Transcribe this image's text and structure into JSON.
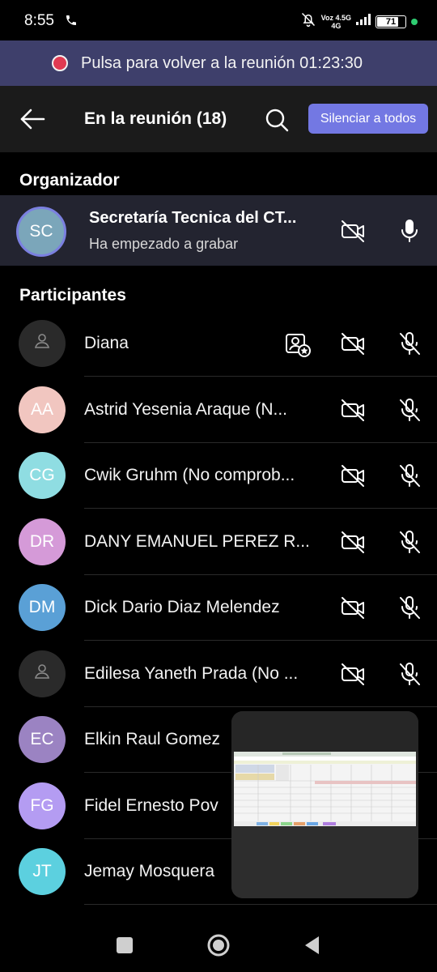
{
  "status_bar": {
    "time": "8:55",
    "net_top": "Voz 4.5G",
    "net_bottom": "4G",
    "battery": "71"
  },
  "banner": {
    "text": "Pulsa para volver a la reunión 01:23:30"
  },
  "header": {
    "title": "En la reunión (18)",
    "mute_all_label": "Silenciar a todos"
  },
  "organizer_section": {
    "title": "Organizador",
    "organizer": {
      "initials": "SC",
      "name": "Secretaría Tecnica  del CT...",
      "status": "Ha empezado a grabar"
    }
  },
  "participants_section": {
    "title": "Participantes",
    "participants": [
      {
        "initials": "",
        "name": "Diana",
        "avatar_color": "#2a2a2a"
      },
      {
        "initials": "AA",
        "name": "Astrid Yesenia  Araque (N...",
        "avatar_color": "#f1c6c0"
      },
      {
        "initials": "CG",
        "name": "Cwik Gruhm (No comprob...",
        "avatar_color": "#8fdde2"
      },
      {
        "initials": "DR",
        "name": "DANY EMANUEL PEREZ R...",
        "avatar_color": "#d59ad8"
      },
      {
        "initials": "DM",
        "name": "Dick Dario Diaz Melendez",
        "avatar_color": "#5aa0d6"
      },
      {
        "initials": "",
        "name": "Edilesa Yaneth Prada (No ...",
        "avatar_color": "#2a2a2a"
      },
      {
        "initials": "EC",
        "name": "Elkin Raul Gomez",
        "avatar_color": "#9b83c2"
      },
      {
        "initials": "FG",
        "name": "Fidel Ernesto Pov",
        "avatar_color": "#b49cf2"
      },
      {
        "initials": "JT",
        "name": "Jemay Mosquera",
        "avatar_color": "#5cd0df"
      }
    ]
  },
  "colors": {
    "accent": "#7378e3",
    "banner_bg": "#3e3f6b",
    "recording": "#e03a52"
  }
}
